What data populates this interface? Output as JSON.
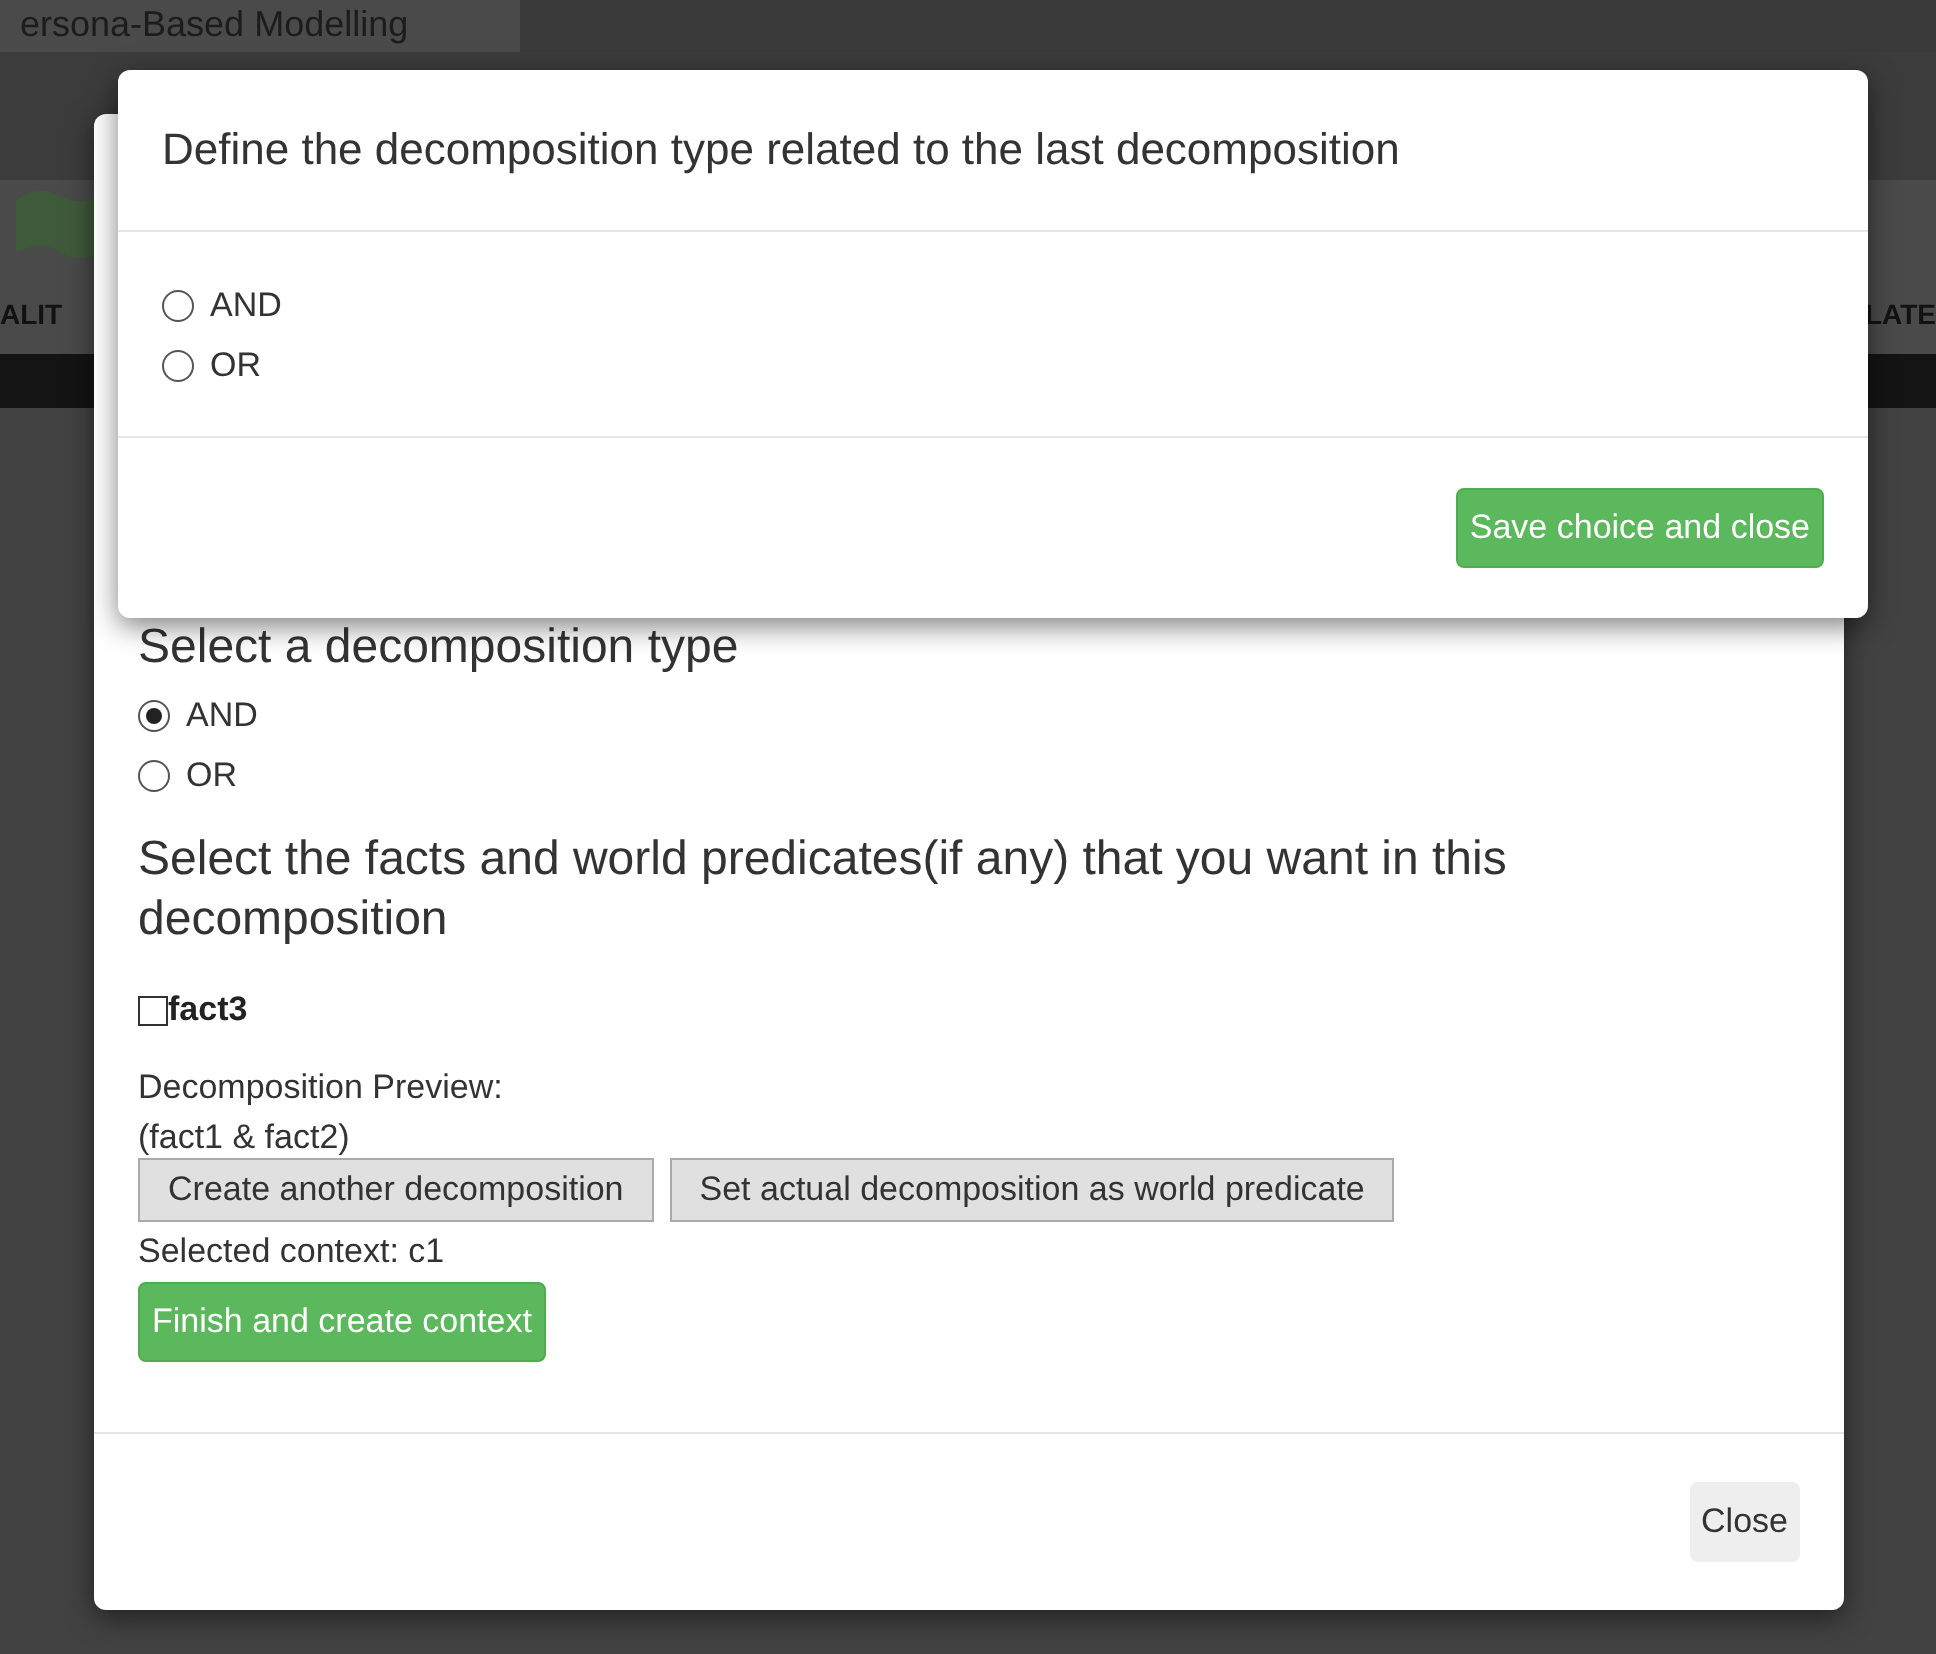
{
  "page": {
    "title": "ersona-Based Modelling",
    "nav_left": "ALIT",
    "nav_right": "LATE"
  },
  "decomposition_dialog": {
    "heading": "Select a decomposition type",
    "types": [
      {
        "label": "AND",
        "selected": true
      },
      {
        "label": "OR",
        "selected": false
      }
    ],
    "facts_heading": "Select the facts and world predicates(if any) that you want in this decomposition",
    "facts": [
      {
        "label": "fact3",
        "checked": false
      }
    ],
    "preview_label": "Decomposition Preview:",
    "preview": "(fact1 & fact2)",
    "buttons": [
      "Create another decomposition",
      "Set actual decomposition as world predicate"
    ],
    "context": "Selected context: c1",
    "finish_button": "Finish and create context",
    "close_button": "Close"
  },
  "type_dialog": {
    "title": "Define the decomposition type related to the last decomposition",
    "options": [
      {
        "label": "AND",
        "selected": false
      },
      {
        "label": "OR",
        "selected": false
      }
    ],
    "save_button": "Save choice and close"
  }
}
